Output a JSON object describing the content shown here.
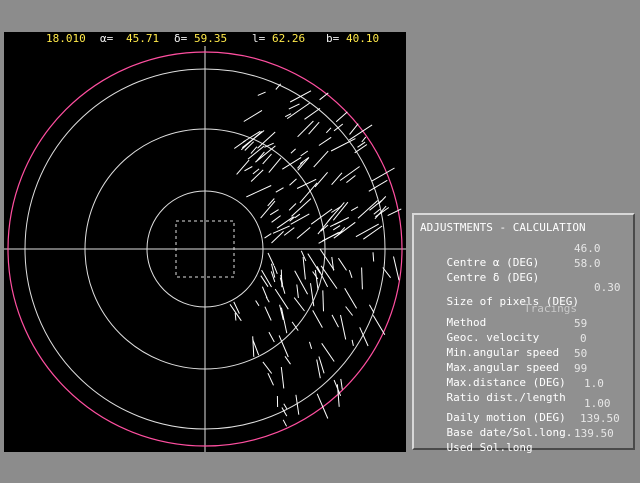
{
  "status": {
    "time": "18.010",
    "alpha_label": "α=",
    "alpha": "45.71",
    "delta_label": "δ=",
    "delta": "59.35",
    "l_label": "l=",
    "l": "62.26",
    "b_label": "b=",
    "b": "40.10"
  },
  "panel": {
    "title": "ADJUSTMENTS - CALCULATION",
    "rows": [
      {
        "label": "Centre α (DEG)",
        "value": "46.0"
      },
      {
        "label": "Centre δ (DEG)",
        "value": "58.0"
      },
      {
        "label": "Size of pixels (DEG)",
        "value": "0.30"
      },
      {
        "label": "Method",
        "value": "Tracings"
      },
      {
        "label": "Geoc. velocity",
        "value": "59"
      },
      {
        "label": "Min.angular speed",
        "value": "0"
      },
      {
        "label": "Max.angular speed",
        "value": "50"
      },
      {
        "label": "Max.distance (DEG)",
        "value": "99"
      },
      {
        "label": "Ratio dist./length",
        "value": "1.0"
      },
      {
        "label": "Daily motion (DEG)",
        "value": "1.00"
      },
      {
        "label": "Base date/Sol.long.",
        "value": "139.50"
      },
      {
        "label": "Used Sol.long",
        "value": "139.50"
      }
    ]
  },
  "colors": {
    "status_value": "#ffe94a",
    "outer_circle": "#ff4fa0",
    "grid": "#e0e0e0",
    "tracings": "#ffffff",
    "panel_bg": "#909090",
    "desktop_bg": "#8c8c8c"
  }
}
